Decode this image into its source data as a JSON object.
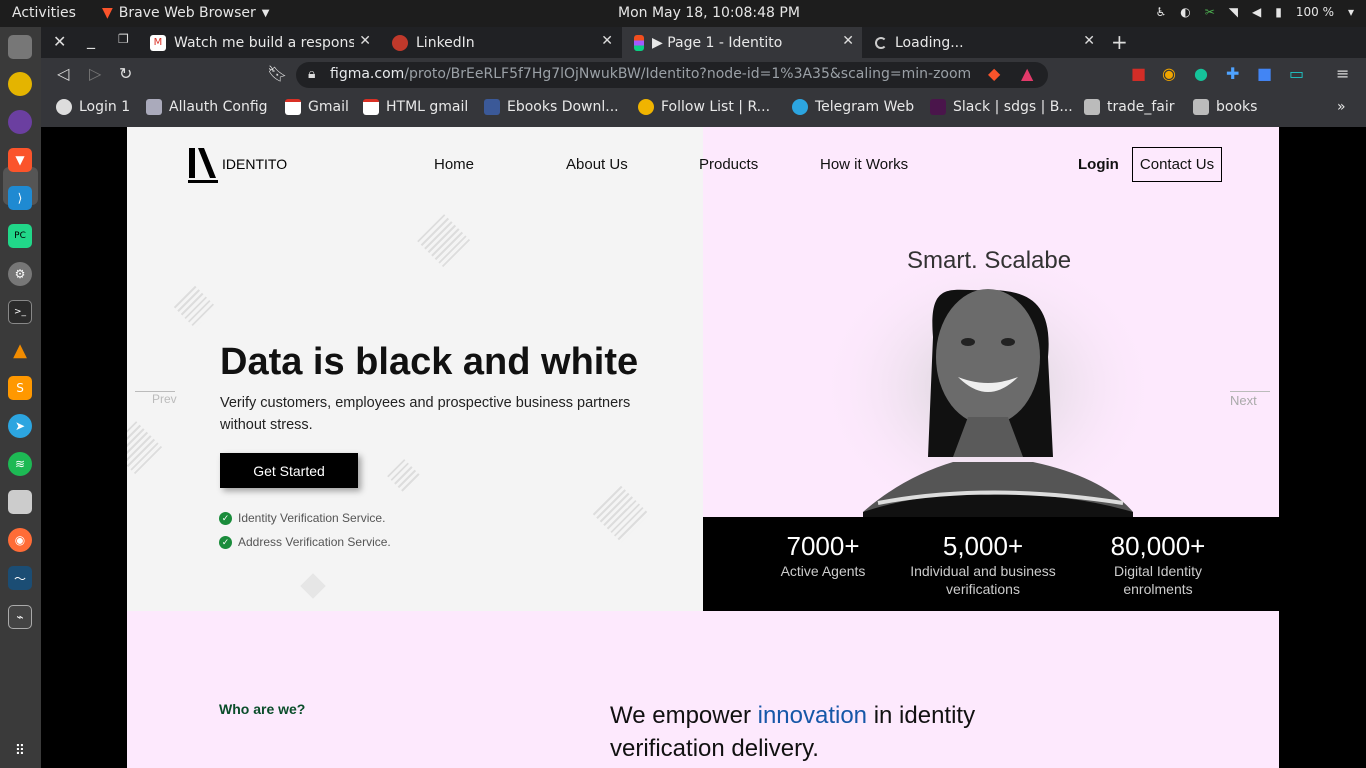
{
  "system": {
    "activities": "Activities",
    "app_name": "Brave Web Browser",
    "clock": "Mon May 18, 10:08:48 PM",
    "battery": "100 %"
  },
  "browser": {
    "tabs": [
      {
        "title": "Watch me build a responsive",
        "active": false
      },
      {
        "title": "LinkedIn",
        "active": false
      },
      {
        "title": "▶ Page 1 - Identito",
        "active": true
      },
      {
        "title": "Loading...",
        "active": false
      }
    ],
    "url_host": "figma.com",
    "url_path": "/proto/BrEeRLF5f7Hg7lOjNwukBW/Identito?node-id=1%3A35&scaling=min-zoom",
    "bookmarks": [
      "Login 1",
      "Allauth Config",
      "Gmail",
      "HTML gmail",
      "Ebooks Downl...",
      "Follow List | R...",
      "Telegram Web",
      "Slack | sdgs | B...",
      "trade_fair",
      "books"
    ]
  },
  "site": {
    "logo_text": "IDENTITO",
    "nav": [
      "Home",
      "About Us",
      "Products",
      "How it Works"
    ],
    "login": "Login",
    "contact": "Contact Us",
    "headline": "Data is black and white",
    "subtext": "Verify customers, employees and prospective business partners without stress.",
    "cta": "Get Started",
    "checks": [
      "Identity Verification Service.",
      "Address Verification Service."
    ],
    "prev": "Prev",
    "next": "Next",
    "tagline": "Smart. Scalabe",
    "stats": [
      {
        "num": "7000+",
        "label": "Active Agents"
      },
      {
        "num": "5,000+",
        "label": "Individual and business verifications"
      },
      {
        "num": "80,000+",
        "label": "Digital Identity enrolments"
      }
    ],
    "who": "Who are we?",
    "empower_pre": "We empower ",
    "empower_hl": "innovation",
    "empower_post": " in identity verification delivery."
  }
}
